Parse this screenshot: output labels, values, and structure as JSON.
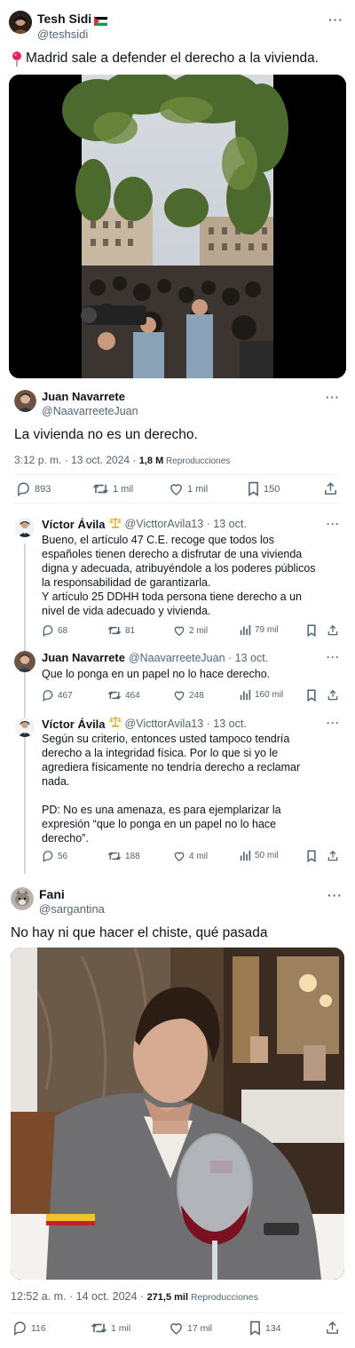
{
  "tweet1": {
    "name": "Tesh Sidi",
    "handle": "@teshsidi",
    "pin": "📍",
    "text": "Madrid sale a defender el derecho a la vivienda."
  },
  "quoted": {
    "name": "Juan Navarrete",
    "handle": "@NaavarreeteJuan",
    "text": "La vivienda no es un derecho.",
    "time": "3:12 p. m. · 13 oct. 2024 · ",
    "views": "1,8 M",
    "views_label": " Reproducciones",
    "replies": "893",
    "retweets": "1 mil",
    "likes": "1 mil",
    "bookmarks": "150"
  },
  "replies": [
    {
      "name": "Víctor Ávila",
      "badge": "⚖️",
      "handle": "@VicttorAvila13 · 13 oct.",
      "lines": [
        "Bueno, el artículo 47 C.E. recoge que todos los",
        "españoles tienen derecho a disfrutar de una vivienda",
        "digna y adecuada, atribuyéndole a los poderes públicos",
        "la responsabilidad de garantizarla.",
        "Y artículo 25 DDHH toda persona tiene derecho a un",
        "nivel de vida adecuado y vivienda."
      ],
      "replies": "68",
      "retweets": "81",
      "likes": "2 mil",
      "views": "79 mil"
    },
    {
      "name": "Juan Navarrete",
      "handle": "@NaavarreeteJuan · 13 oct.",
      "lines": [
        "Que lo ponga en un papel no lo hace derecho."
      ],
      "replies": "467",
      "retweets": "464",
      "likes": "248",
      "views": "160 mil"
    },
    {
      "name": "Víctor Ávila",
      "badge": "⚖️",
      "handle": "@VicttorAvila13 · 13 oct.",
      "lines": [
        "Según su criterio, entonces usted tampoco tendría",
        "derecho a la integridad física. Por lo que si yo le",
        "agrediera físicamente no tendría derecho a reclamar",
        "nada.",
        "",
        "PD: No es una amenaza, es para ejemplarizar la",
        "expresión  “que lo ponga en un papel no lo hace",
        "derecho”."
      ],
      "replies": "56",
      "retweets": "188",
      "likes": "4 mil",
      "views": "50 mil"
    }
  ],
  "tweet2": {
    "name": "Fani",
    "handle": "@sargantina",
    "text": "No hay ni que hacer el chiste, qué pasada",
    "time": "12:52 a. m. · 14 oct. 2024 · ",
    "views": "271,5 mil",
    "views_label": " Reproducciones",
    "replies": "116",
    "retweets": "1 mil",
    "likes": "17 mil",
    "bookmarks": "134"
  },
  "more_label": "···",
  "flag_label": "Palestine flag",
  "icons": [
    "pin-icon",
    "palestine-flag-icon",
    "scales-badge-icon",
    "reply-icon",
    "retweet-icon",
    "like-icon",
    "views-icon",
    "bookmark-icon",
    "share-icon",
    "more-icon"
  ]
}
